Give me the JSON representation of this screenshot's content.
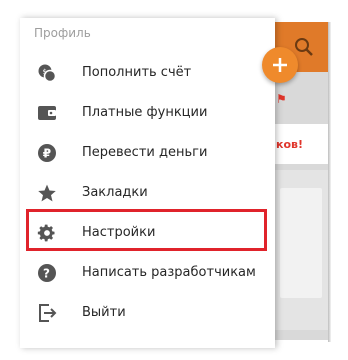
{
  "drawer": {
    "section_title": "Профиль",
    "items": [
      {
        "label": "Пополнить счёт",
        "icon": "coins-icon"
      },
      {
        "label": "Платные функции",
        "icon": "wallet-icon"
      },
      {
        "label": "Перевести деньги",
        "icon": "ruble-icon"
      },
      {
        "label": "Закладки",
        "icon": "star-icon"
      },
      {
        "label": "Настройки",
        "icon": "gear-icon"
      },
      {
        "label": "Написать разработчикам",
        "icon": "help-icon"
      },
      {
        "label": "Выйти",
        "icon": "exit-icon"
      }
    ],
    "highlighted_item": "Настройки"
  },
  "background": {
    "promo_text": "ков!",
    "toolbar_color": "#e07a29",
    "fab_color": "#ef8a2c",
    "highlight_color": "#e0232b"
  }
}
